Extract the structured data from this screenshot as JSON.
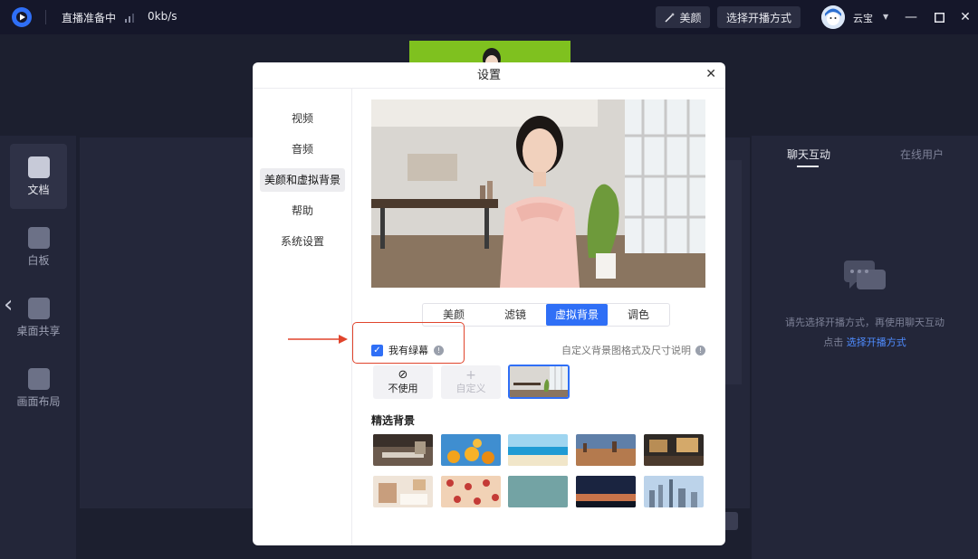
{
  "topbar": {
    "status": "直播准备中",
    "bitrate": "0kb/s",
    "beauty_label": "美颜",
    "select_mode_label": "选择开播方式",
    "username": "云宝",
    "icons": {
      "logo": "app-logo-icon",
      "signal": "signal-icon",
      "magic": "magic-wand-icon"
    }
  },
  "rail": {
    "items": [
      {
        "label": "文档",
        "icon": "document-icon",
        "active": true
      },
      {
        "label": "白板",
        "icon": "whiteboard-icon",
        "active": false
      },
      {
        "label": "桌面共享",
        "icon": "screen-share-icon",
        "active": false
      },
      {
        "label": "画面布局",
        "icon": "layout-icon",
        "active": false
      }
    ]
  },
  "right_panel": {
    "tabs": [
      "聊天互动",
      "在线用户"
    ],
    "hint_line1": "请先选择开播方式，再使用聊天互动",
    "hint_prefix": "点击",
    "hint_link": "选择开播方式"
  },
  "dialog": {
    "title": "设置",
    "nav": [
      "视频",
      "音频",
      "美颜和虚拟背景",
      "帮助",
      "系统设置"
    ],
    "active_nav_index": 2,
    "tabs": [
      "美颜",
      "滤镜",
      "虚拟背景",
      "调色"
    ],
    "active_tab_index": 2,
    "greenscreen_label": "我有绿幕",
    "greenscreen_checked": true,
    "custom_note": "自定义背景图格式及尺寸说明",
    "tile_none_label": "不使用",
    "tile_custom_label": "自定义",
    "tile_none_icon": "no-entry-icon",
    "tile_custom_icon": "plus-icon",
    "featured_title": "精选背景"
  },
  "colors": {
    "accent": "#2f6ff6",
    "highlight": "#e0442c",
    "link": "#4f8cff"
  }
}
